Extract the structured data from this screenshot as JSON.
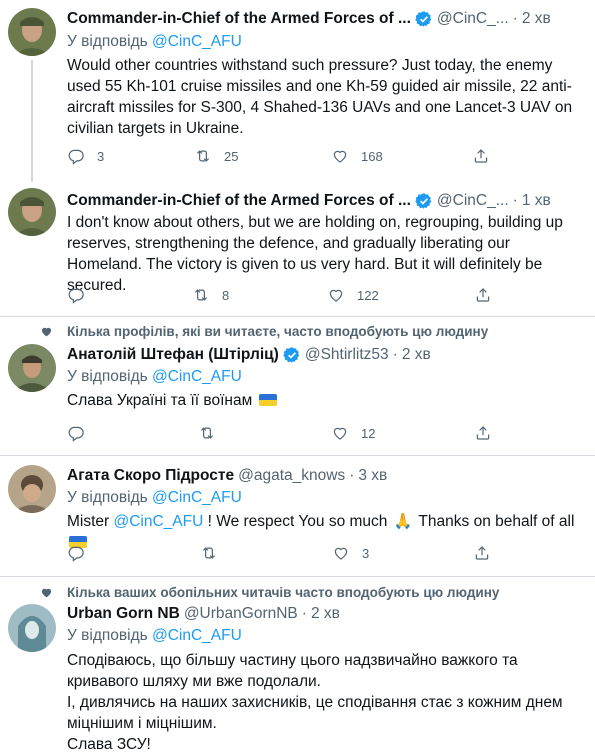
{
  "tweets": [
    {
      "name": "Commander-in-Chief of the Armed Forces of ...",
      "handle": "@CinC_...",
      "dot": "·",
      "time": "2 хв",
      "reply_prefix": "У відповідь",
      "reply_handle": "@CinC_AFU",
      "text": "Would other countries withstand such pressure? Just today, the enemy used 55 Kh-101 cruise missiles and one Kh-59 guided air missile, 22 anti-aircraft missiles for S-300, 4 Shahed-136 UAVs and one Lancet-3 UAV on civilian targets in Ukraine.",
      "replies": "3",
      "retweets": "25",
      "likes": "168"
    },
    {
      "name": "Commander-in-Chief of the Armed Forces of ...",
      "handle": "@CinC_...",
      "dot": "·",
      "time": "1 хв",
      "text": "I don't know about others, but we are holding on, regrouping, building up reserves, strengthening the defence, and gradually liberating our Homeland. The victory is given to us very hard. But it will definitely be secured.",
      "replies": "",
      "retweets": "8",
      "likes": "122"
    },
    {
      "social_context": "Кілька профілів, які ви читаєте, часто вподобують цю людину",
      "name": "Анатолій Штефан (Штірліц)",
      "handle": "@Shtirlitz53",
      "dot": "·",
      "time": "2 хв",
      "reply_prefix": "У відповідь",
      "reply_handle": "@CinC_AFU",
      "text": "Слава Україні та її воїнам",
      "replies": "",
      "retweets": "",
      "likes": "12"
    },
    {
      "name": "Агата Скоро Підросте",
      "handle": "@agata_knows",
      "dot": "·",
      "time": "3 хв",
      "reply_prefix": "У відповідь",
      "reply_handle": "@CinC_AFU",
      "text_pre": "Mister ",
      "text_mention": "@CinC_AFU",
      "text_mid": " ! We respect You so much ",
      "text_post": " Thanks on behalf of all ",
      "replies": "",
      "retweets": "",
      "likes": "3"
    },
    {
      "social_context": "Кілька ваших обопільних читачів часто вподобують цю людину",
      "name": "Urban Gorn NB",
      "handle": "@UrbanGornNB",
      "dot": "·",
      "time": "2 хв",
      "reply_prefix": "У відповідь",
      "reply_handle": "@CinC_AFU",
      "text_line1": "Сподіваюсь, що більшу частину цього надзвичайно важкого та кривавого шляху ми вже подолали.",
      "text_line2": "І, дивлячись на наших захисників, це сподівання стає з кожним днем міцнішим і міцнішим.",
      "text_line3": "Слава ЗСУ!"
    }
  ],
  "icons": {
    "reply": "reply-icon",
    "retweet": "retweet-icon",
    "like": "heart-icon",
    "share": "share-icon",
    "verified": "verified-badge-icon",
    "social": "heart-small-icon",
    "more": "more-icon"
  },
  "colors": {
    "link": "#1d9bf0",
    "muted": "#536471",
    "verified": "#1d9bf0",
    "text": "#0f1419"
  }
}
